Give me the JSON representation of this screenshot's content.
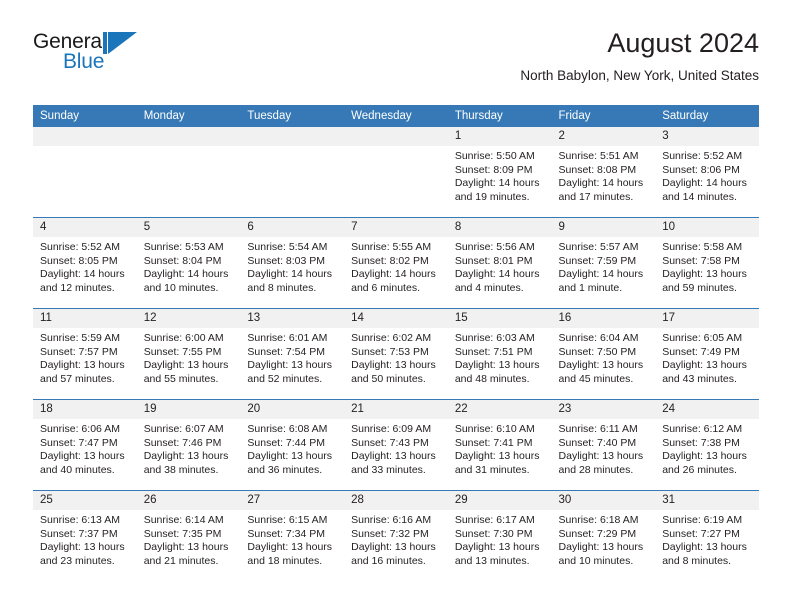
{
  "brand": {
    "name_part1": "General",
    "name_part2": "Blue",
    "mark": "triangle-logo",
    "accent_color": "#1b75bb"
  },
  "header": {
    "title": "August 2024",
    "subtitle": "North Babylon, New York, United States"
  },
  "theme": {
    "header_blue": "#3679b6",
    "daynum_band": "#f1f1f1",
    "text": "#231f20"
  },
  "calendar": {
    "weekday_headers": [
      "Sunday",
      "Monday",
      "Tuesday",
      "Wednesday",
      "Thursday",
      "Friday",
      "Saturday"
    ],
    "labels": {
      "sunrise": "Sunrise:",
      "sunset": "Sunset:",
      "daylight": "Daylight:"
    },
    "weeks": [
      [
        {
          "day": "",
          "sunrise": "",
          "sunset": "",
          "daylight_line1": "",
          "daylight_line2": ""
        },
        {
          "day": "",
          "sunrise": "",
          "sunset": "",
          "daylight_line1": "",
          "daylight_line2": ""
        },
        {
          "day": "",
          "sunrise": "",
          "sunset": "",
          "daylight_line1": "",
          "daylight_line2": ""
        },
        {
          "day": "",
          "sunrise": "",
          "sunset": "",
          "daylight_line1": "",
          "daylight_line2": ""
        },
        {
          "day": "1",
          "sunrise": "Sunrise: 5:50 AM",
          "sunset": "Sunset: 8:09 PM",
          "daylight_line1": "Daylight: 14 hours",
          "daylight_line2": "and 19 minutes."
        },
        {
          "day": "2",
          "sunrise": "Sunrise: 5:51 AM",
          "sunset": "Sunset: 8:08 PM",
          "daylight_line1": "Daylight: 14 hours",
          "daylight_line2": "and 17 minutes."
        },
        {
          "day": "3",
          "sunrise": "Sunrise: 5:52 AM",
          "sunset": "Sunset: 8:06 PM",
          "daylight_line1": "Daylight: 14 hours",
          "daylight_line2": "and 14 minutes."
        }
      ],
      [
        {
          "day": "4",
          "sunrise": "Sunrise: 5:52 AM",
          "sunset": "Sunset: 8:05 PM",
          "daylight_line1": "Daylight: 14 hours",
          "daylight_line2": "and 12 minutes."
        },
        {
          "day": "5",
          "sunrise": "Sunrise: 5:53 AM",
          "sunset": "Sunset: 8:04 PM",
          "daylight_line1": "Daylight: 14 hours",
          "daylight_line2": "and 10 minutes."
        },
        {
          "day": "6",
          "sunrise": "Sunrise: 5:54 AM",
          "sunset": "Sunset: 8:03 PM",
          "daylight_line1": "Daylight: 14 hours",
          "daylight_line2": "and 8 minutes."
        },
        {
          "day": "7",
          "sunrise": "Sunrise: 5:55 AM",
          "sunset": "Sunset: 8:02 PM",
          "daylight_line1": "Daylight: 14 hours",
          "daylight_line2": "and 6 minutes."
        },
        {
          "day": "8",
          "sunrise": "Sunrise: 5:56 AM",
          "sunset": "Sunset: 8:01 PM",
          "daylight_line1": "Daylight: 14 hours",
          "daylight_line2": "and 4 minutes."
        },
        {
          "day": "9",
          "sunrise": "Sunrise: 5:57 AM",
          "sunset": "Sunset: 7:59 PM",
          "daylight_line1": "Daylight: 14 hours",
          "daylight_line2": "and 1 minute."
        },
        {
          "day": "10",
          "sunrise": "Sunrise: 5:58 AM",
          "sunset": "Sunset: 7:58 PM",
          "daylight_line1": "Daylight: 13 hours",
          "daylight_line2": "and 59 minutes."
        }
      ],
      [
        {
          "day": "11",
          "sunrise": "Sunrise: 5:59 AM",
          "sunset": "Sunset: 7:57 PM",
          "daylight_line1": "Daylight: 13 hours",
          "daylight_line2": "and 57 minutes."
        },
        {
          "day": "12",
          "sunrise": "Sunrise: 6:00 AM",
          "sunset": "Sunset: 7:55 PM",
          "daylight_line1": "Daylight: 13 hours",
          "daylight_line2": "and 55 minutes."
        },
        {
          "day": "13",
          "sunrise": "Sunrise: 6:01 AM",
          "sunset": "Sunset: 7:54 PM",
          "daylight_line1": "Daylight: 13 hours",
          "daylight_line2": "and 52 minutes."
        },
        {
          "day": "14",
          "sunrise": "Sunrise: 6:02 AM",
          "sunset": "Sunset: 7:53 PM",
          "daylight_line1": "Daylight: 13 hours",
          "daylight_line2": "and 50 minutes."
        },
        {
          "day": "15",
          "sunrise": "Sunrise: 6:03 AM",
          "sunset": "Sunset: 7:51 PM",
          "daylight_line1": "Daylight: 13 hours",
          "daylight_line2": "and 48 minutes."
        },
        {
          "day": "16",
          "sunrise": "Sunrise: 6:04 AM",
          "sunset": "Sunset: 7:50 PM",
          "daylight_line1": "Daylight: 13 hours",
          "daylight_line2": "and 45 minutes."
        },
        {
          "day": "17",
          "sunrise": "Sunrise: 6:05 AM",
          "sunset": "Sunset: 7:49 PM",
          "daylight_line1": "Daylight: 13 hours",
          "daylight_line2": "and 43 minutes."
        }
      ],
      [
        {
          "day": "18",
          "sunrise": "Sunrise: 6:06 AM",
          "sunset": "Sunset: 7:47 PM",
          "daylight_line1": "Daylight: 13 hours",
          "daylight_line2": "and 40 minutes."
        },
        {
          "day": "19",
          "sunrise": "Sunrise: 6:07 AM",
          "sunset": "Sunset: 7:46 PM",
          "daylight_line1": "Daylight: 13 hours",
          "daylight_line2": "and 38 minutes."
        },
        {
          "day": "20",
          "sunrise": "Sunrise: 6:08 AM",
          "sunset": "Sunset: 7:44 PM",
          "daylight_line1": "Daylight: 13 hours",
          "daylight_line2": "and 36 minutes."
        },
        {
          "day": "21",
          "sunrise": "Sunrise: 6:09 AM",
          "sunset": "Sunset: 7:43 PM",
          "daylight_line1": "Daylight: 13 hours",
          "daylight_line2": "and 33 minutes."
        },
        {
          "day": "22",
          "sunrise": "Sunrise: 6:10 AM",
          "sunset": "Sunset: 7:41 PM",
          "daylight_line1": "Daylight: 13 hours",
          "daylight_line2": "and 31 minutes."
        },
        {
          "day": "23",
          "sunrise": "Sunrise: 6:11 AM",
          "sunset": "Sunset: 7:40 PM",
          "daylight_line1": "Daylight: 13 hours",
          "daylight_line2": "and 28 minutes."
        },
        {
          "day": "24",
          "sunrise": "Sunrise: 6:12 AM",
          "sunset": "Sunset: 7:38 PM",
          "daylight_line1": "Daylight: 13 hours",
          "daylight_line2": "and 26 minutes."
        }
      ],
      [
        {
          "day": "25",
          "sunrise": "Sunrise: 6:13 AM",
          "sunset": "Sunset: 7:37 PM",
          "daylight_line1": "Daylight: 13 hours",
          "daylight_line2": "and 23 minutes."
        },
        {
          "day": "26",
          "sunrise": "Sunrise: 6:14 AM",
          "sunset": "Sunset: 7:35 PM",
          "daylight_line1": "Daylight: 13 hours",
          "daylight_line2": "and 21 minutes."
        },
        {
          "day": "27",
          "sunrise": "Sunrise: 6:15 AM",
          "sunset": "Sunset: 7:34 PM",
          "daylight_line1": "Daylight: 13 hours",
          "daylight_line2": "and 18 minutes."
        },
        {
          "day": "28",
          "sunrise": "Sunrise: 6:16 AM",
          "sunset": "Sunset: 7:32 PM",
          "daylight_line1": "Daylight: 13 hours",
          "daylight_line2": "and 16 minutes."
        },
        {
          "day": "29",
          "sunrise": "Sunrise: 6:17 AM",
          "sunset": "Sunset: 7:30 PM",
          "daylight_line1": "Daylight: 13 hours",
          "daylight_line2": "and 13 minutes."
        },
        {
          "day": "30",
          "sunrise": "Sunrise: 6:18 AM",
          "sunset": "Sunset: 7:29 PM",
          "daylight_line1": "Daylight: 13 hours",
          "daylight_line2": "and 10 minutes."
        },
        {
          "day": "31",
          "sunrise": "Sunrise: 6:19 AM",
          "sunset": "Sunset: 7:27 PM",
          "daylight_line1": "Daylight: 13 hours",
          "daylight_line2": "and 8 minutes."
        }
      ]
    ]
  }
}
